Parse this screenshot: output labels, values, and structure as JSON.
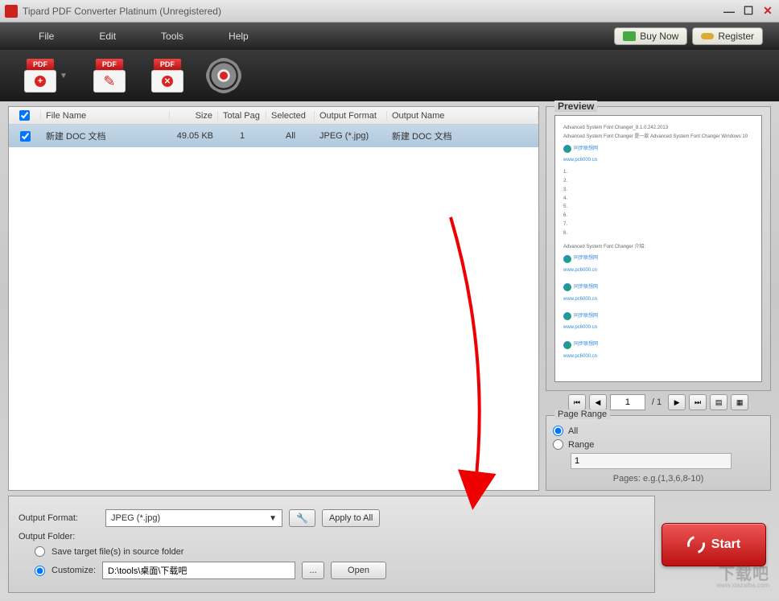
{
  "window": {
    "title": "Tipard PDF Converter Platinum (Unregistered)"
  },
  "menubar": {
    "file": "File",
    "edit": "Edit",
    "tools": "Tools",
    "help": "Help",
    "buy_now": "Buy Now",
    "register": "Register"
  },
  "table": {
    "headers": {
      "filename": "File Name",
      "size": "Size",
      "total_pages": "Total Pag",
      "selected": "Selected",
      "output_format": "Output Format",
      "output_name": "Output Name"
    },
    "rows": [
      {
        "checked": true,
        "filename": "新建 DOC 文档",
        "size": "49.05 KB",
        "total_pages": "1",
        "selected": "All",
        "output_format": "JPEG (*.jpg)",
        "output_name": "新建 DOC 文档"
      }
    ]
  },
  "preview": {
    "title": "Preview",
    "doc_line1": "Advanced System Font Changer_8.1.0.242.2013",
    "doc_line2": "Advanced System Font Changer 是一款 Advanced System Font Changer Windows 10",
    "watermark_text": "同步联想网",
    "watermark_url": "www.pc6000.cn",
    "nav": {
      "current_page": "1",
      "total_pages": "/ 1"
    }
  },
  "page_range": {
    "title": "Page Range",
    "all_label": "All",
    "range_label": "Range",
    "range_value": "1",
    "hint": "Pages: e.g.(1,3,6,8-10)"
  },
  "output": {
    "format_label": "Output Format:",
    "format_value": "JPEG (*.jpg)",
    "apply_all": "Apply to All",
    "folder_label": "Output Folder:",
    "source_folder_label": "Save target file(s) in source folder",
    "customize_label": "Customize:",
    "customize_path": "D:\\tools\\桌面\\下载吧",
    "browse_dots": "...",
    "open_label": "Open"
  },
  "start_button": "Start",
  "footer": {
    "brand": "下载吧",
    "url": "www.xiazaiba.com"
  }
}
